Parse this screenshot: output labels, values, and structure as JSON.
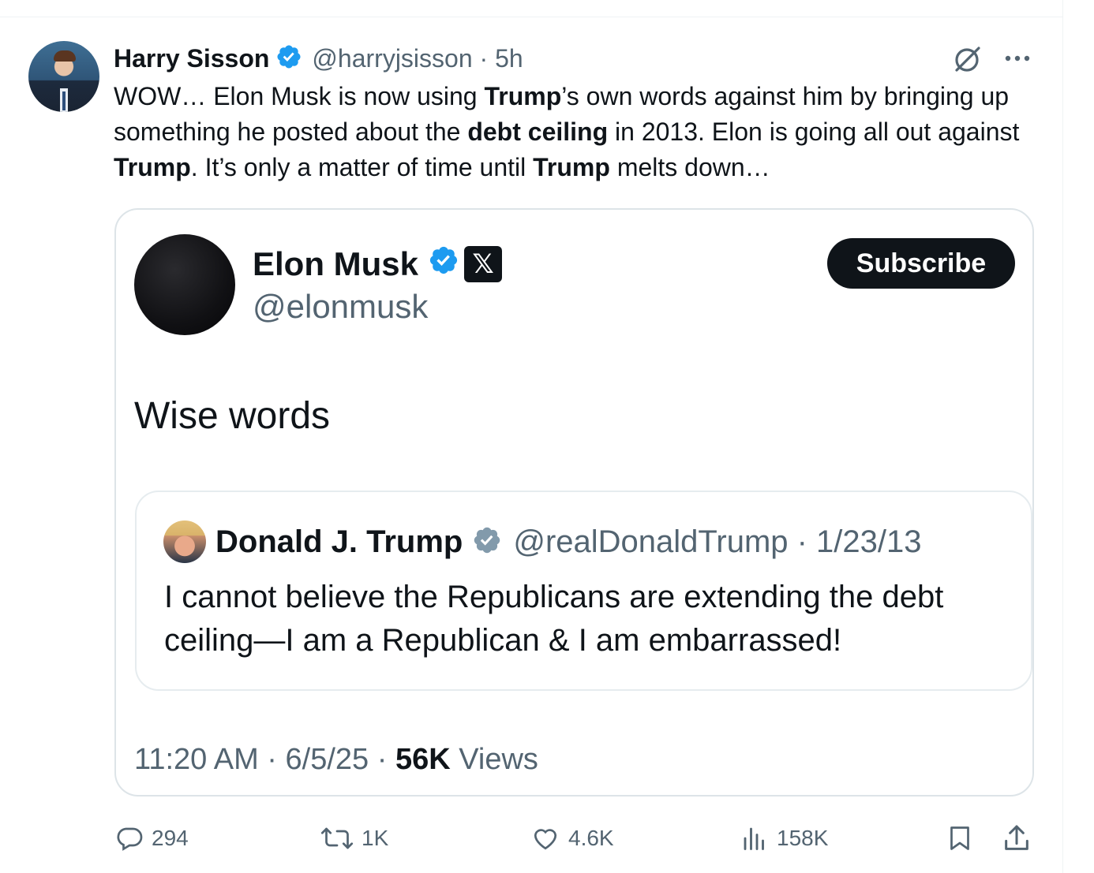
{
  "post": {
    "author_name": "Harry Sisson",
    "author_handle": "@harryjsisson · 5h",
    "text_parts": [
      "WOW… Elon Musk is now using ",
      "Trump",
      "’s own words against him by bringing up something he posted about the ",
      "debt ceiling",
      " in 2013. Elon is going all out against ",
      "Trump",
      ". It’s only a matter of time until ",
      "Trump",
      " melts down…"
    ]
  },
  "quoted": {
    "author_name": "Elon Musk",
    "author_handle": "@elonmusk",
    "badge_label": "𝕏",
    "subscribe_label": "Subscribe",
    "text": "Wise words",
    "timestamp_prefix": "11:20 AM · 6/5/25 · ",
    "views_count": "56K",
    "views_label": " Views",
    "nested": {
      "author_name": "Donald J. Trump",
      "author_handle": "@realDonaldTrump · 1/23/13",
      "text": "I cannot believe the Republicans are extending the debt ceiling—I am a Republican & I am embarrassed!"
    }
  },
  "actions": {
    "replies": "294",
    "reposts": "1K",
    "likes": "4.6K",
    "views": "158K"
  },
  "colors": {
    "verified_blue": "#1d9bf0",
    "verified_gray": "#829aab",
    "muted_text": "#536471",
    "primary_text": "#0f1419",
    "border": "#dde4e8"
  },
  "icons": [
    "verified-badge-icon",
    "grok-icon",
    "more-icon",
    "reply-icon",
    "repost-icon",
    "like-icon",
    "views-icon",
    "bookmark-icon",
    "share-icon"
  ]
}
